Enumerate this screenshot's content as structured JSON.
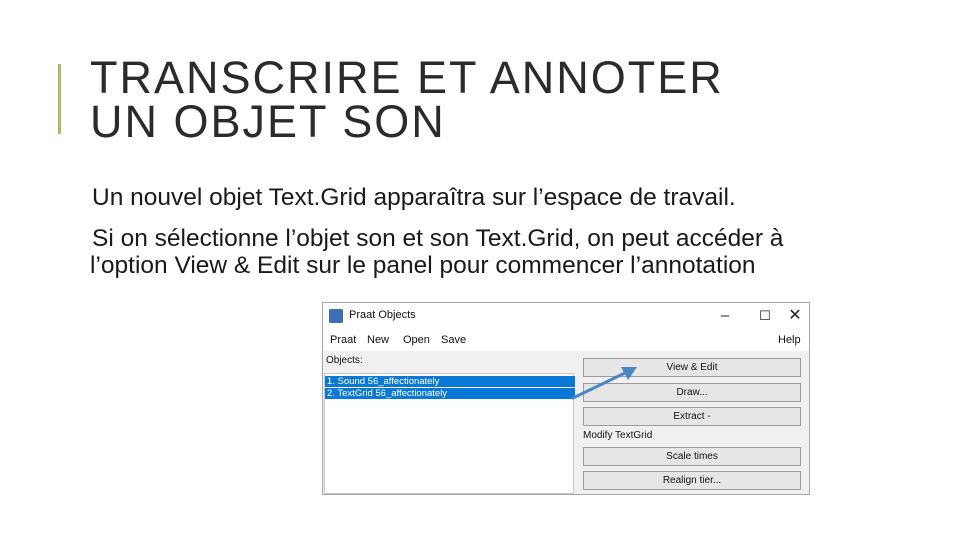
{
  "slide": {
    "title_line1": "TRANSCRIRE ET ANNOTER",
    "title_line2": "UN OBJET SON",
    "paragraph1": "Un nouvel objet Text.Grid apparaîtra sur l’espace de travail.",
    "paragraph2": "Si on sélectionne l’objet son et son Text.Grid, on peut accéder à l’option View & Edit sur le panel pour commencer l’annotation"
  },
  "praat_window": {
    "title": "Praat Objects",
    "controls": {
      "minimize": "–",
      "maximize": "☐",
      "close": "✕"
    },
    "menu": [
      "Praat",
      "New",
      "Open",
      "Save",
      "Help"
    ],
    "objects_label": "Objects:",
    "objects": [
      "1. Sound 56_affectionately",
      "2. TextGrid 56_affectionately"
    ],
    "buttons": {
      "view_edit": "View & Edit",
      "draw": "Draw...",
      "extract": "Extract -",
      "scale_times": "Scale times",
      "realign_tier": "Realign tier..."
    },
    "section_label": "Modify TextGrid"
  },
  "colors": {
    "accent": "#b3b86e",
    "selection": "#0a78d7",
    "arrow": "#4a86c6"
  },
  "icons": {
    "app": "praat-app-icon",
    "arrow": "annotation-arrow"
  }
}
